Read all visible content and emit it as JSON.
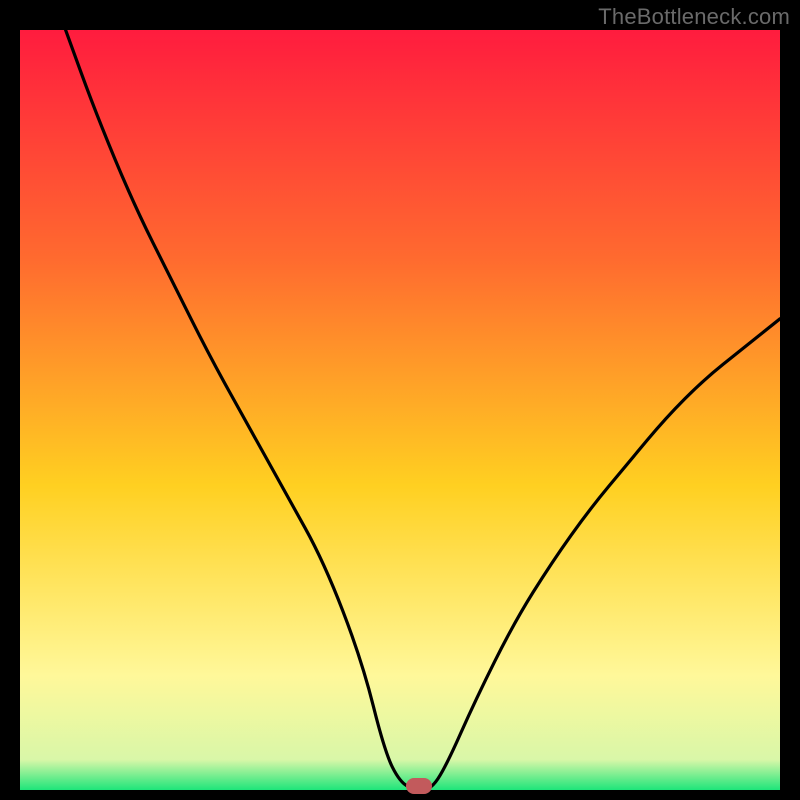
{
  "watermark": "TheBottleneck.com",
  "colors": {
    "frame": "#000000",
    "grad_top": "#ff1c3e",
    "grad_upper": "#ff6a2f",
    "grad_mid": "#ffd021",
    "grad_lower": "#fff89a",
    "grad_bottom": "#1ee57a",
    "curve": "#000000",
    "marker": "#c25a5c",
    "watermark": "#6a6a6a"
  },
  "chart_data": {
    "type": "line",
    "title": "",
    "xlabel": "",
    "ylabel": "",
    "xlim": [
      0,
      100
    ],
    "ylim": [
      0,
      100
    ],
    "grid": false,
    "legend": false,
    "series": [
      {
        "name": "bottleneck-curve",
        "x": [
          6,
          10,
          15,
          20,
          25,
          30,
          35,
          40,
          45,
          48,
          50,
          52,
          54,
          56,
          60,
          65,
          70,
          75,
          80,
          85,
          90,
          95,
          100
        ],
        "y": [
          100,
          89,
          77,
          67,
          57,
          48,
          39,
          30,
          17,
          5,
          1,
          0,
          0,
          3,
          12,
          22,
          30,
          37,
          43,
          49,
          54,
          58,
          62
        ]
      }
    ],
    "annotations": [
      {
        "name": "optimal-marker",
        "x": 52.5,
        "y": 0,
        "shape": "pill",
        "color": "#c25a5c"
      }
    ]
  }
}
